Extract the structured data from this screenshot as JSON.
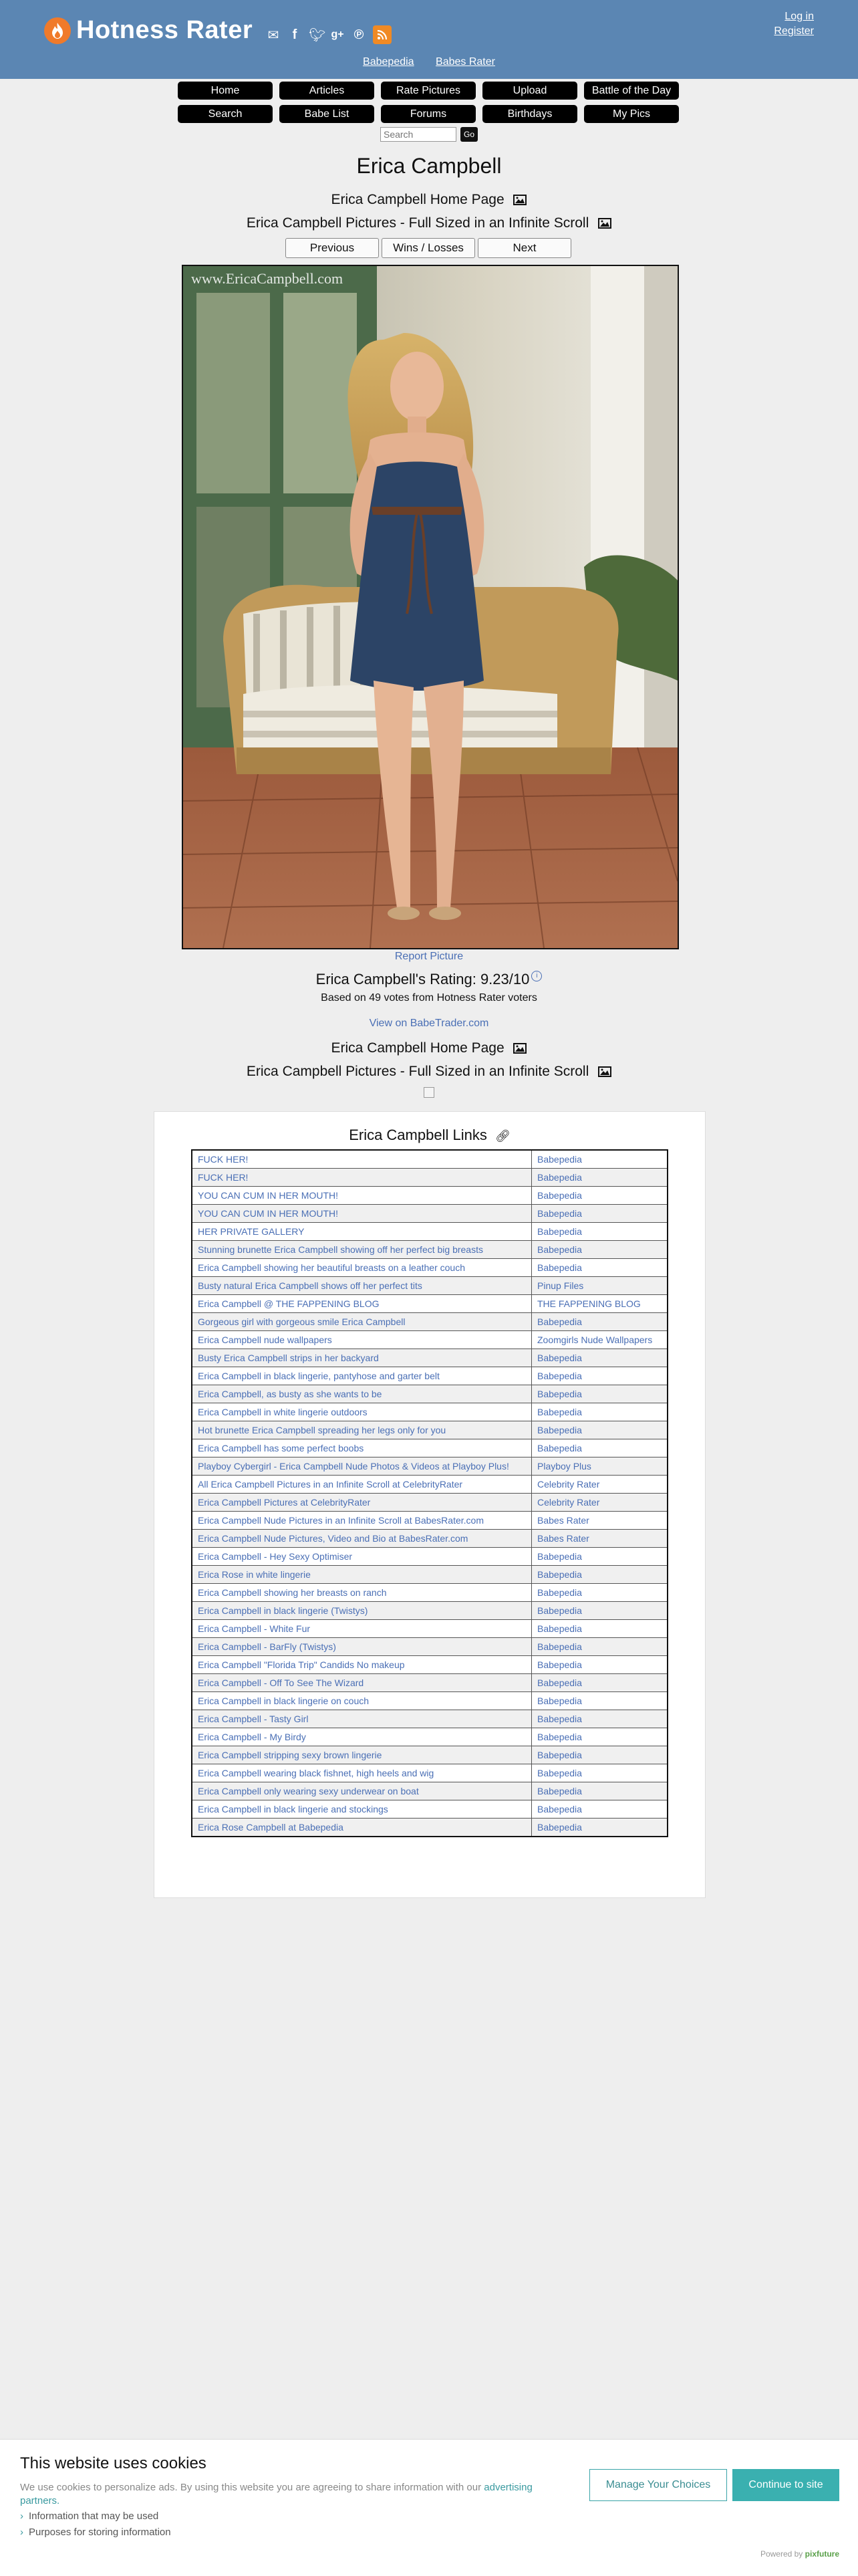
{
  "header": {
    "site_name": "Hotness Rater",
    "login": "Log in",
    "register": "Register",
    "links": [
      "Babepedia",
      "Babes Rater"
    ]
  },
  "nav": [
    "Home",
    "Articles",
    "Rate Pictures",
    "Upload",
    "Battle of the Day",
    "Search",
    "Babe List",
    "Forums",
    "Birthdays",
    "My Pics"
  ],
  "search": {
    "placeholder": "Search",
    "go": "Go"
  },
  "page": {
    "title": "Erica Campbell",
    "home_link": "Erica Campbell Home Page",
    "pictures_link": "Erica Campbell Pictures - Full Sized in an Infinite Scroll",
    "prev": "Previous",
    "wins": "Wins / Losses",
    "next": "Next",
    "watermark": "www.EricaCampbell.com",
    "report": "Report Picture",
    "rating": "Erica Campbell's Rating: 9.23/10",
    "votes": "Based on 49 votes from Hotness Rater voters",
    "babetrader": "View on BabeTrader.com",
    "home_link2": "Erica Campbell Home Page",
    "pictures_link2": "Erica Campbell Pictures - Full Sized in an Infinite Scroll"
  },
  "links_section": {
    "title": "Erica Campbell Links",
    "rows": [
      {
        "title": "FUCK HER!",
        "source": "Babepedia"
      },
      {
        "title": "FUCK HER!",
        "source": "Babepedia"
      },
      {
        "title": "YOU CAN CUM IN HER MOUTH!",
        "source": "Babepedia"
      },
      {
        "title": "YOU CAN CUM IN HER MOUTH!",
        "source": "Babepedia"
      },
      {
        "title": "HER PRIVATE GALLERY",
        "source": "Babepedia"
      },
      {
        "title": "Stunning brunette Erica Campbell showing off her perfect big breasts",
        "source": "Babepedia"
      },
      {
        "title": "Erica Campbell showing her beautiful breasts on a leather couch",
        "source": "Babepedia"
      },
      {
        "title": "Busty natural Erica Campbell shows off her perfect tits",
        "source": "Pinup Files"
      },
      {
        "title": "Erica Campbell @ THE FAPPENING BLOG",
        "source": "THE FAPPENING BLOG"
      },
      {
        "title": "Gorgeous girl with gorgeous smile Erica Campbell",
        "source": "Babepedia"
      },
      {
        "title": "Erica Campbell nude wallpapers",
        "source": "Zoomgirls Nude Wallpapers"
      },
      {
        "title": "Busty Erica Campbell strips in her backyard",
        "source": "Babepedia"
      },
      {
        "title": "Erica Campbell in black lingerie, pantyhose and garter belt",
        "source": "Babepedia"
      },
      {
        "title": "Erica Campbell, as busty as she wants to be",
        "source": "Babepedia"
      },
      {
        "title": "Erica Campbell in white lingerie outdoors",
        "source": "Babepedia"
      },
      {
        "title": "Hot brunette Erica Campbell spreading her legs only for you",
        "source": "Babepedia"
      },
      {
        "title": "Erica Campbell has some perfect boobs",
        "source": "Babepedia"
      },
      {
        "title": "Playboy Cybergirl - Erica Campbell Nude Photos & Videos at Playboy Plus!",
        "source": "Playboy Plus"
      },
      {
        "title": "All Erica Campbell Pictures in an Infinite Scroll at CelebrityRater",
        "source": "Celebrity Rater"
      },
      {
        "title": "Erica Campbell Pictures at CelebrityRater",
        "source": "Celebrity Rater"
      },
      {
        "title": "Erica Campbell Nude Pictures in an Infinite Scroll at BabesRater.com",
        "source": "Babes Rater"
      },
      {
        "title": "Erica Campbell Nude Pictures, Video and Bio at BabesRater.com",
        "source": "Babes Rater"
      },
      {
        "title": "Erica Campbell - Hey Sexy Optimiser",
        "source": "Babepedia"
      },
      {
        "title": "Erica Rose in white lingerie",
        "source": "Babepedia"
      },
      {
        "title": "Erica Campbell showing her breasts on ranch",
        "source": "Babepedia"
      },
      {
        "title": "Erica Campbell in black lingerie (Twistys)",
        "source": "Babepedia"
      },
      {
        "title": "Erica Campbell - White Fur",
        "source": "Babepedia"
      },
      {
        "title": "Erica Campbell - BarFly (Twistys)",
        "source": "Babepedia"
      },
      {
        "title": "Erica Campbell \"Florida Trip\" Candids No makeup",
        "source": "Babepedia"
      },
      {
        "title": "Erica Campbell - Off To See The Wizard",
        "source": "Babepedia"
      },
      {
        "title": "Erica Campbell in black lingerie on couch",
        "source": "Babepedia"
      },
      {
        "title": "Erica Campbell - Tasty Girl",
        "source": "Babepedia"
      },
      {
        "title": "Erica Campbell - My Birdy",
        "source": "Babepedia"
      },
      {
        "title": "Erica Campbell stripping sexy brown lingerie",
        "source": "Babepedia"
      },
      {
        "title": "Erica Campbell wearing black fishnet, high heels and wig",
        "source": "Babepedia"
      },
      {
        "title": "Erica Campbell only wearing sexy underwear on boat",
        "source": "Babepedia"
      },
      {
        "title": "Erica Campbell in black lingerie and stockings",
        "source": "Babepedia"
      },
      {
        "title": "Erica Rose Campbell at Babepedia",
        "source": "Babepedia"
      }
    ]
  },
  "cookie": {
    "title": "This website uses cookies",
    "text": "We use cookies to personalize ads. By using this website you are agreeing to share information with our",
    "partners": "advertising partners.",
    "item1": "Information that may be used",
    "item2": "Purposes for storing information",
    "manage": "Manage Your Choices",
    "continue": "Continue to site",
    "powered": "Powered by",
    "powered_brand": "pixfuture"
  },
  "colors": {
    "header": "#5b86b3",
    "link": "#4a6fb5",
    "accent": "#3ab0b0"
  }
}
